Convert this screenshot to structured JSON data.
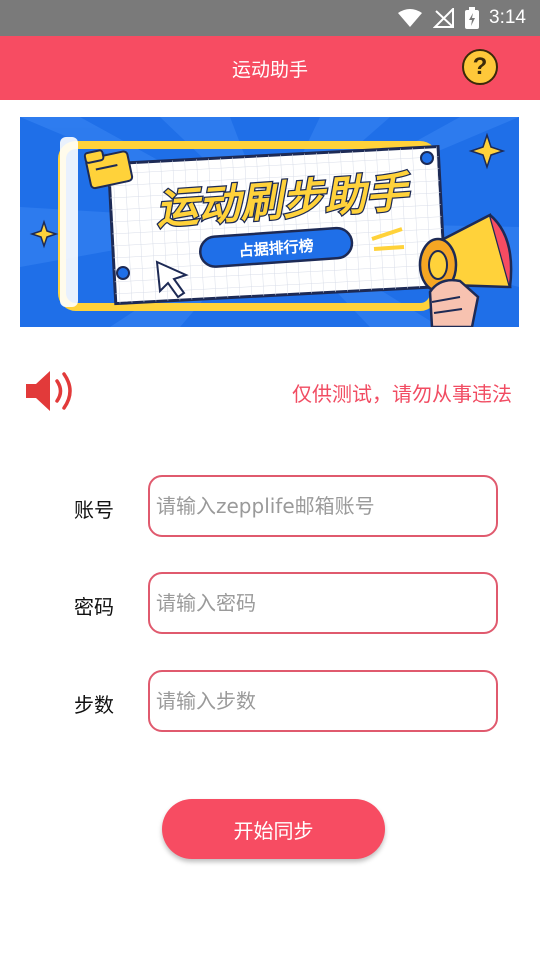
{
  "status_bar": {
    "time": "3:14"
  },
  "app_bar": {
    "title": "运动助手",
    "help_label": "?"
  },
  "banner": {
    "headline": "运动刷步助手",
    "subline": "占据排行榜"
  },
  "notice": {
    "text": "仅供测试，请勿从事违法"
  },
  "form": {
    "account": {
      "label": "账号",
      "placeholder": "请输入zepplife邮箱账号",
      "value": ""
    },
    "password": {
      "label": "密码",
      "placeholder": "请输入密码",
      "value": ""
    },
    "steps": {
      "label": "步数",
      "placeholder": "请输入步数",
      "value": ""
    }
  },
  "start_button": {
    "label": "开始同步"
  },
  "colors": {
    "accent": "#f74c62",
    "status_bar": "#7a7a7a",
    "banner_blue": "#1f6fe8",
    "banner_yellow": "#ffd23a"
  },
  "icons": {
    "wifi": "wifi-icon",
    "signal": "signal-icon",
    "battery": "battery-icon",
    "help": "help-icon",
    "speaker": "speaker-icon",
    "megaphone": "megaphone-icon"
  }
}
